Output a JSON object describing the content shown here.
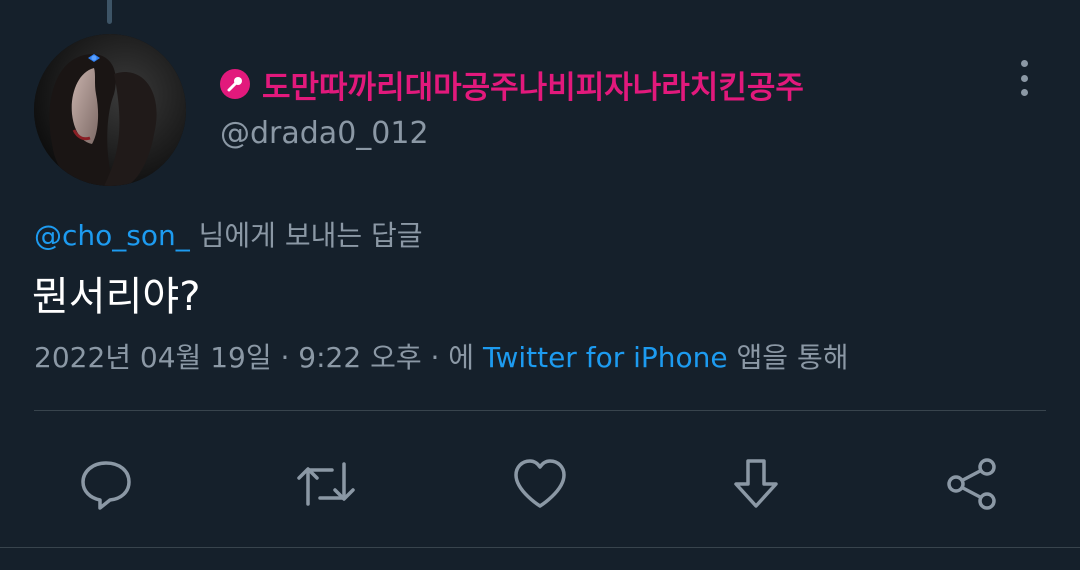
{
  "tweet": {
    "author": {
      "display_name": "도만따까리대마공주나비피자나라치킨공주",
      "handle": "@drada0_012",
      "badge_icon": "microphone-icon",
      "name_color": "#e2197c"
    },
    "reply_to": {
      "mention": "@cho_son_",
      "suffix": " 님에게 보내는 답글"
    },
    "text": "뭔서리야?",
    "meta": {
      "timestamp": "2022년 04월 19일 · 9:22 오후 · 에 ",
      "source": "Twitter for iPhone",
      "source_suffix": " 앱을 통해"
    }
  },
  "actions": [
    {
      "name": "reply",
      "icon": "speech-bubble-icon"
    },
    {
      "name": "retweet",
      "icon": "retweet-icon"
    },
    {
      "name": "like",
      "icon": "heart-icon"
    },
    {
      "name": "download",
      "icon": "download-arrow-icon"
    },
    {
      "name": "share",
      "icon": "share-icon"
    }
  ],
  "colors": {
    "background": "#15202b",
    "accent": "#1d9bf0",
    "secondary_text": "#8b98a5",
    "primary_text": "#ffffff"
  }
}
